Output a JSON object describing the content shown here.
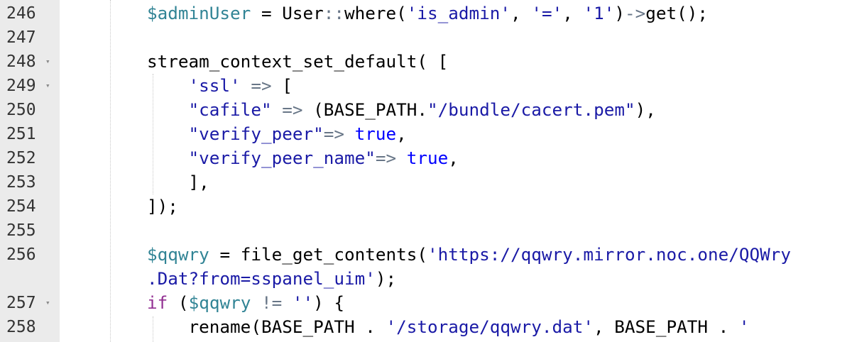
{
  "colors": {
    "gutter": "#ebebeb",
    "variable": "#318495",
    "string": "#1a1aa6",
    "keyword_true": "#0000ff",
    "control": "#912e91",
    "operator": "#687687"
  },
  "lines": [
    {
      "num": "246",
      "fold": false,
      "indent": "        ",
      "tokens": [
        {
          "t": "$adminUser",
          "c": "var"
        },
        {
          "t": " = ",
          "c": "plain"
        },
        {
          "t": "User",
          "c": "plain"
        },
        {
          "t": "::",
          "c": "op"
        },
        {
          "t": "where(",
          "c": "plain"
        },
        {
          "t": "'is_admin'",
          "c": "str"
        },
        {
          "t": ", ",
          "c": "plain"
        },
        {
          "t": "'='",
          "c": "str"
        },
        {
          "t": ", ",
          "c": "plain"
        },
        {
          "t": "'1'",
          "c": "str"
        },
        {
          "t": ")",
          "c": "plain"
        },
        {
          "t": "->",
          "c": "op"
        },
        {
          "t": "get();",
          "c": "plain"
        }
      ]
    },
    {
      "num": "247",
      "fold": false,
      "indent": "",
      "tokens": []
    },
    {
      "num": "248",
      "fold": true,
      "indent": "        ",
      "tokens": [
        {
          "t": "stream_context_set_default( [",
          "c": "plain"
        }
      ]
    },
    {
      "num": "249",
      "fold": true,
      "indent": "            ",
      "tokens": [
        {
          "t": "'ssl'",
          "c": "str"
        },
        {
          "t": " => ",
          "c": "op"
        },
        {
          "t": "[",
          "c": "plain"
        }
      ]
    },
    {
      "num": "250",
      "fold": false,
      "indent": "            ",
      "tokens": [
        {
          "t": "\"cafile\"",
          "c": "str"
        },
        {
          "t": " => ",
          "c": "op"
        },
        {
          "t": "(BASE_PATH.",
          "c": "plain"
        },
        {
          "t": "\"/bundle/cacert.pem\"",
          "c": "str"
        },
        {
          "t": "),",
          "c": "plain"
        }
      ]
    },
    {
      "num": "251",
      "fold": false,
      "indent": "            ",
      "tokens": [
        {
          "t": "\"verify_peer\"",
          "c": "str"
        },
        {
          "t": "=> ",
          "c": "op"
        },
        {
          "t": "true",
          "c": "kw"
        },
        {
          "t": ",",
          "c": "plain"
        }
      ]
    },
    {
      "num": "252",
      "fold": false,
      "indent": "            ",
      "tokens": [
        {
          "t": "\"verify_peer_name\"",
          "c": "str"
        },
        {
          "t": "=> ",
          "c": "op"
        },
        {
          "t": "true",
          "c": "kw"
        },
        {
          "t": ",",
          "c": "plain"
        }
      ]
    },
    {
      "num": "253",
      "fold": false,
      "indent": "            ",
      "tokens": [
        {
          "t": "],",
          "c": "plain"
        }
      ]
    },
    {
      "num": "254",
      "fold": false,
      "indent": "        ",
      "tokens": [
        {
          "t": "]);",
          "c": "plain"
        }
      ]
    },
    {
      "num": "255",
      "fold": false,
      "indent": "",
      "tokens": []
    },
    {
      "num": "256",
      "fold": false,
      "indent": "        ",
      "tokens": [
        {
          "t": "$qqwry",
          "c": "var"
        },
        {
          "t": " = ",
          "c": "plain"
        },
        {
          "t": "file_get_contents(",
          "c": "plain"
        },
        {
          "t": "'https://qqwry.mirror.noc.one/QQWry",
          "c": "str"
        }
      ]
    },
    {
      "num": "",
      "fold": false,
      "indent": "        ",
      "tokens": [
        {
          "t": ".Dat?from=sspanel_uim'",
          "c": "str"
        },
        {
          "t": ");",
          "c": "plain"
        }
      ]
    },
    {
      "num": "257",
      "fold": true,
      "indent": "        ",
      "tokens": [
        {
          "t": "if",
          "c": "ctl"
        },
        {
          "t": " (",
          "c": "plain"
        },
        {
          "t": "$qqwry",
          "c": "var"
        },
        {
          "t": " != ",
          "c": "op"
        },
        {
          "t": "''",
          "c": "str"
        },
        {
          "t": ") {",
          "c": "plain"
        }
      ]
    },
    {
      "num": "258",
      "fold": false,
      "indent": "            ",
      "tokens": [
        {
          "t": "rename(BASE_PATH . ",
          "c": "plain"
        },
        {
          "t": "'/storage/qqwry.dat'",
          "c": "str"
        },
        {
          "t": ", BASE_PATH . ",
          "c": "plain"
        },
        {
          "t": "'",
          "c": "str"
        }
      ]
    }
  ],
  "icons": {
    "fold": "fold-arrow-icon"
  }
}
